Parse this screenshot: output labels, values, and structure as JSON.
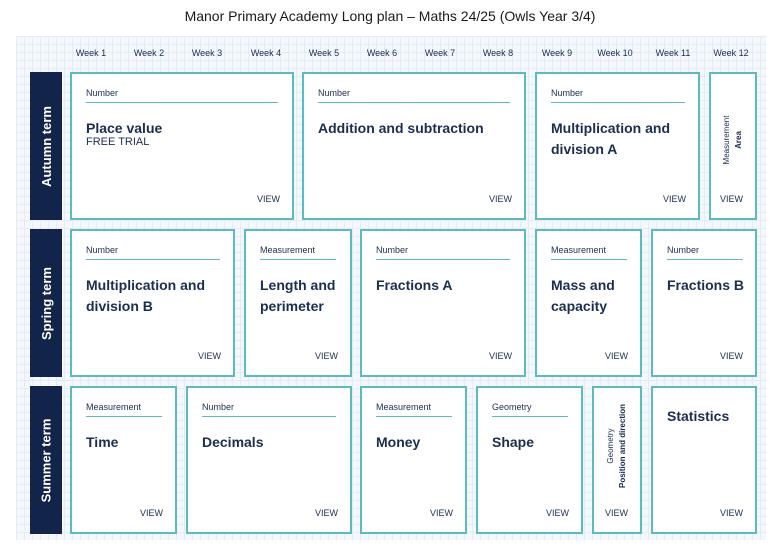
{
  "title": "Manor Primary Academy Long plan – Maths 24/25 (Owls Year 3/4)",
  "weeks": [
    "Week 1",
    "Week 2",
    "Week 3",
    "Week 4",
    "Week 5",
    "Week 6",
    "Week 7",
    "Week 8",
    "Week 9",
    "Week 10",
    "Week 11",
    "Week 12"
  ],
  "terms": {
    "autumn": "Autumn term",
    "spring": "Spring term",
    "summer": "Summer term"
  },
  "view_label": "VIEW",
  "autumn": {
    "place_value": {
      "category": "Number",
      "name": "Place value",
      "note": "FREE TRIAL"
    },
    "addition": {
      "category": "Number",
      "name": "Addition and subtraction"
    },
    "multiplication_a": {
      "category": "Number",
      "name": "Multiplication and division A"
    },
    "area": {
      "category": "Measurement",
      "name": "Area"
    }
  },
  "spring": {
    "multiplication_b": {
      "category": "Number",
      "name": "Multiplication and division B"
    },
    "length": {
      "category": "Measurement",
      "name": "Length and perimeter"
    },
    "fractions_a": {
      "category": "Number",
      "name": "Fractions A"
    },
    "mass": {
      "category": "Measurement",
      "name": "Mass and capacity"
    },
    "fractions_b": {
      "category": "Number",
      "name": "Fractions B"
    }
  },
  "summer": {
    "time": {
      "category": "Measurement",
      "name": "Time"
    },
    "decimals": {
      "category": "Number",
      "name": "Decimals"
    },
    "money": {
      "category": "Measurement",
      "name": "Money"
    },
    "shape": {
      "category": "Geometry",
      "name": "Shape"
    },
    "position": {
      "category": "Geometry",
      "name": "Position and direction"
    },
    "statistics": {
      "name": "Statistics"
    }
  }
}
